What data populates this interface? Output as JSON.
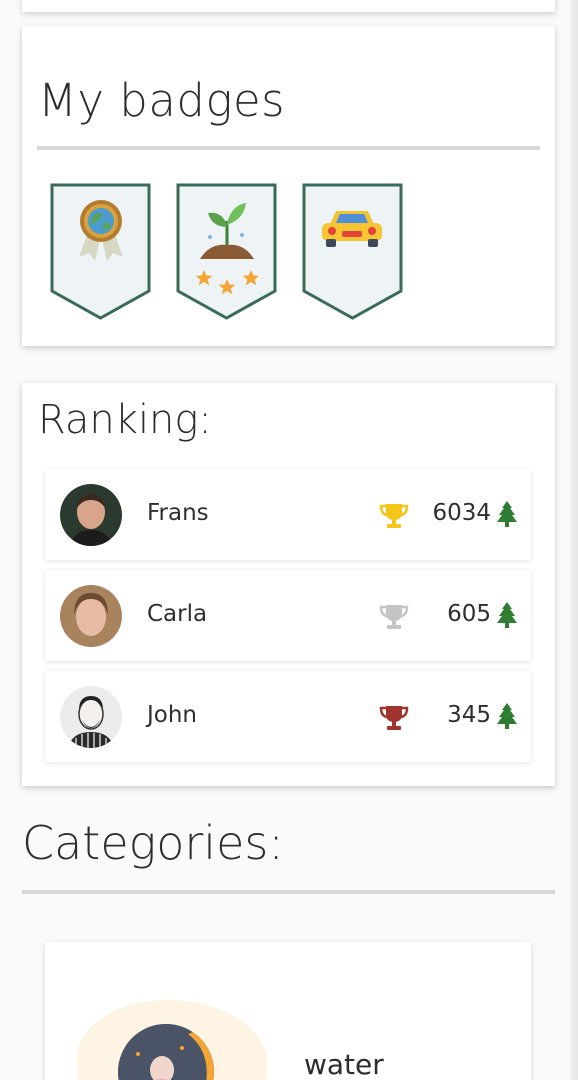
{
  "badges_section": {
    "title": "My badges",
    "badges": [
      {
        "icon": "earth-award-ribbon-icon"
      },
      {
        "icon": "sprouting-plant-stars-icon"
      },
      {
        "icon": "yellow-car-icon"
      }
    ]
  },
  "ranking_section": {
    "title": "Ranking:",
    "rows": [
      {
        "name": "Frans",
        "score": "6034",
        "trophy_color": "#f5c518",
        "trophy_icon": "gold-trophy-icon"
      },
      {
        "name": "Carla",
        "score": "605",
        "trophy_color": "#c4c4c4",
        "trophy_icon": "silver-trophy-icon"
      },
      {
        "name": "John",
        "score": "345",
        "trophy_color": "#a0342e",
        "trophy_icon": "bronze-trophy-icon"
      }
    ],
    "score_icon": "pine-tree-icon",
    "tree_color": "#2e7d32"
  },
  "categories_section": {
    "title": "Categories:",
    "items": [
      {
        "label": "water",
        "icon": "water-category-illustration"
      }
    ]
  },
  "colors": {
    "badge_outline": "#3a6b58",
    "badge_fill": "#eef4f6",
    "divider": "#d7d7d7"
  }
}
